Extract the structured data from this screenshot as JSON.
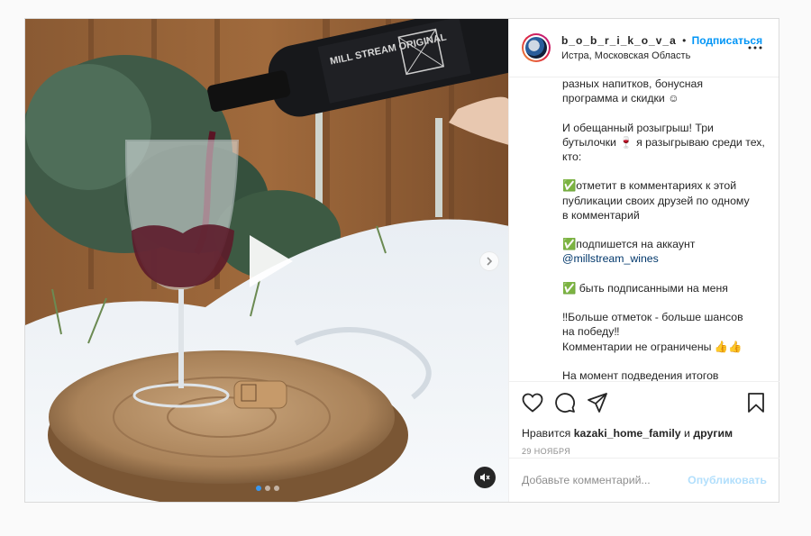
{
  "header": {
    "username": "b_o_b_r_i_k_o_v_a",
    "separator": "•",
    "follow_label": "Подписаться",
    "location": "Истра, Московская Область"
  },
  "caption": {
    "text_before_link": "разных напитков, бонусная\nпрограмма и скидки ☺\n\nИ обещанный розыгрыш! Три\nбутылочки 🍷 я разыгрываю среди тех,\nкто:\n\n✅отметит в комментариях к этой\nпубликации своих друзей по одному\nв комментарий\n\n✅подпишется на аккаунт\n",
    "mention": "@millstream_wines",
    "text_after_link": "\n\n✅ быть подписанными на меня\n\n‼Больше отметок - больше шансов\nна победу‼\nКомментарии не ограничены 👍👍\n\nНа момент подведения итогов"
  },
  "likes": {
    "prefix": "Нравится",
    "user": "kazaki_home_family",
    "conjunction": "и",
    "others": "другим"
  },
  "date": "29 ноября",
  "comment": {
    "placeholder": "Добавьте комментарий...",
    "publish_label": "Опубликовать"
  },
  "media": {
    "bottle_label": "MILL STREAM ORIGINAL",
    "slides_total": 3,
    "active_slide": 1
  },
  "icons": [
    "play-icon",
    "chevron-right-icon",
    "mute-icon",
    "more-icon",
    "heart-icon",
    "comment-icon",
    "share-icon",
    "bookmark-icon"
  ]
}
